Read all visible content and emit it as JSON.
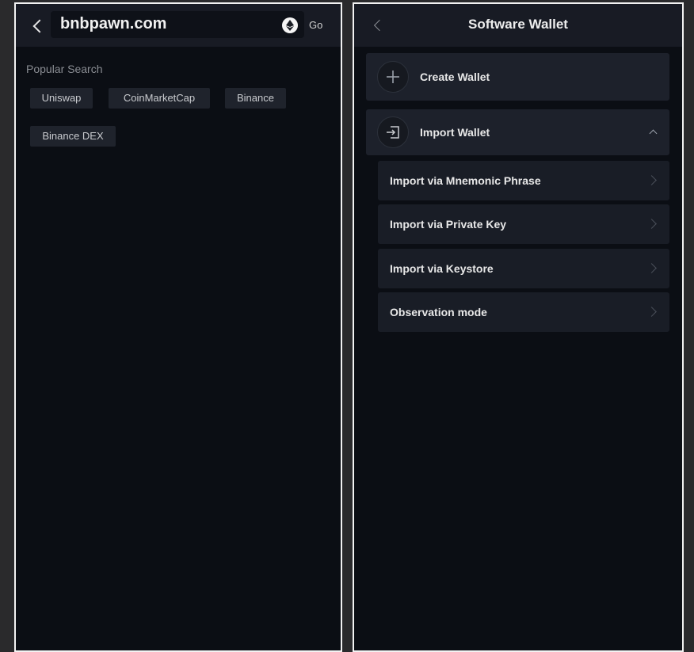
{
  "browser_screen": {
    "url": "bnbpawn.com",
    "go_label": "Go",
    "popular_search_label": "Popular Search",
    "chips": [
      "Uniswap",
      "CoinMarketCap",
      "Binance",
      "Binance DEX"
    ]
  },
  "wallet_screen": {
    "title": "Software Wallet",
    "create_wallet": "Create Wallet",
    "import_wallet": "Import Wallet",
    "import_options": [
      "Import via Mnemonic Phrase",
      "Import via Private Key",
      "Import via Keystore",
      "Observation mode"
    ]
  },
  "icons": {
    "back": "chevron-left-icon",
    "network": "ethereum-icon",
    "create": "plus-icon",
    "import": "import-icon",
    "expand": "chevron-up-icon",
    "row": "chevron-right-icon"
  },
  "colors": {
    "screen_bg": "#0b0e14",
    "header_bg": "#181b24",
    "card_bg": "#1d212b",
    "chip_bg": "#1f232c",
    "text_primary": "#e8e8e8",
    "text_muted": "#8a8d93"
  }
}
